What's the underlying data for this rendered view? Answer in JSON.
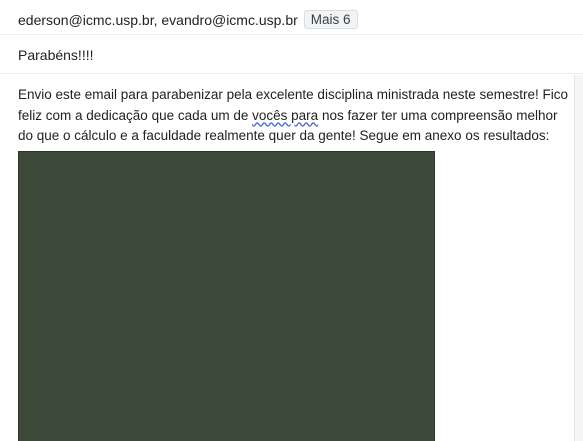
{
  "email": {
    "recipients_text": "ederson@icmc.usp.br, evandro@icmc.usp.br",
    "more_chip": "Mais 6",
    "subject": "Parabéns!!!!",
    "body_part1": "Envio este email para parabenizar pela excelente disciplina ministrada neste semestre! Fico feliz com a dedicação que cada um de ",
    "body_flagged": "vocês para",
    "body_part2": " nos fazer ter uma compreensão melhor do que o cálculo e a faculdade realmente quer da gente! Segue em anexo os resultados:"
  }
}
